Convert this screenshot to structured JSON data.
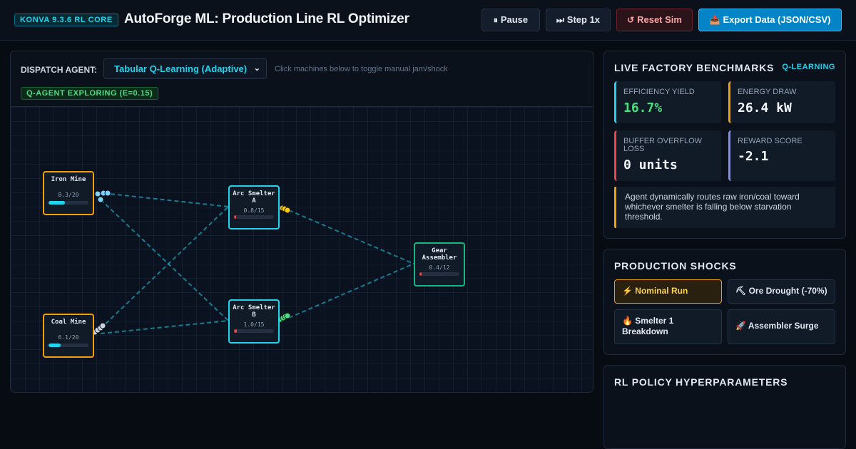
{
  "header": {
    "version_badge": "KONVA 9.3.6 RL CORE",
    "title": "AutoForge ML: Production Line RL Optimizer",
    "buttons": {
      "pause": {
        "icon": "⏸",
        "label": "Pause"
      },
      "step": {
        "icon": "⏭",
        "label": "Step 1x"
      },
      "reset": {
        "icon": "↺",
        "label": "Reset Sim"
      },
      "export": {
        "icon": "📥",
        "label": "Export Data (JSON/CSV)"
      }
    }
  },
  "dispatch": {
    "label": "DISPATCH AGENT:",
    "selected_agent": "Tabular Q-Learning (Adaptive)",
    "hint": "Click machines below to toggle manual jam/shock",
    "status_badge": "Q-AGENT EXPLORING (E=0.15)"
  },
  "machines": [
    {
      "id": "iron",
      "name": "Iron Mine",
      "count": "8.3/20",
      "fill": 0.415,
      "fill_color": "#22d3ee"
    },
    {
      "id": "coal",
      "name": "Coal Mine",
      "count": "6.1/20",
      "fill": 0.305,
      "fill_color": "#22d3ee"
    },
    {
      "id": "smeltA",
      "name": "Arc Smelter A",
      "count": "0.8/15",
      "fill": 0.053,
      "fill_color": "#ef4444"
    },
    {
      "id": "smeltB",
      "name": "Arc Smelter B",
      "count": "1.0/15",
      "fill": 0.067,
      "fill_color": "#ef4444"
    },
    {
      "id": "gear",
      "name": "Gear Assembler",
      "count": "0.4/12",
      "fill": 0.033,
      "fill_color": "#ef4444"
    }
  ],
  "benchmarks": {
    "title": "LIVE FACTORY BENCHMARKS",
    "algorithm": "Q-LEARNING",
    "efficiency": {
      "label": "EFFICIENCY YIELD",
      "value": "16.7%"
    },
    "energy": {
      "label": "ENERGY DRAW",
      "value": "26.4 kW"
    },
    "buffer": {
      "label": "BUFFER OVERFLOW LOSS",
      "value": "0 units"
    },
    "reward": {
      "label": "REWARD SCORE",
      "value": "-2.1"
    },
    "note": "Agent dynamically routes raw iron/coal toward whichever smelter is falling below starvation threshold."
  },
  "shocks": {
    "title": "PRODUCTION SHOCKS",
    "nominal": {
      "icon": "⚡",
      "label": "Nominal Run"
    },
    "drought": {
      "icon": "⛏",
      "label": "Ore Drought (-70%)"
    },
    "breakdown": {
      "icon": "🔥",
      "label": "Smelter 1 Breakdown"
    },
    "surge": {
      "icon": "🚀",
      "label": "Assembler Surge"
    }
  },
  "hyperparams": {
    "title": "RL POLICY HYPERPARAMETERS"
  },
  "colors": {
    "accent": "#22d3ee",
    "mine_border": "#f59e0b",
    "smelter_border": "#22d3ee",
    "assembler_border": "#10b981",
    "starved": "#ef4444"
  }
}
